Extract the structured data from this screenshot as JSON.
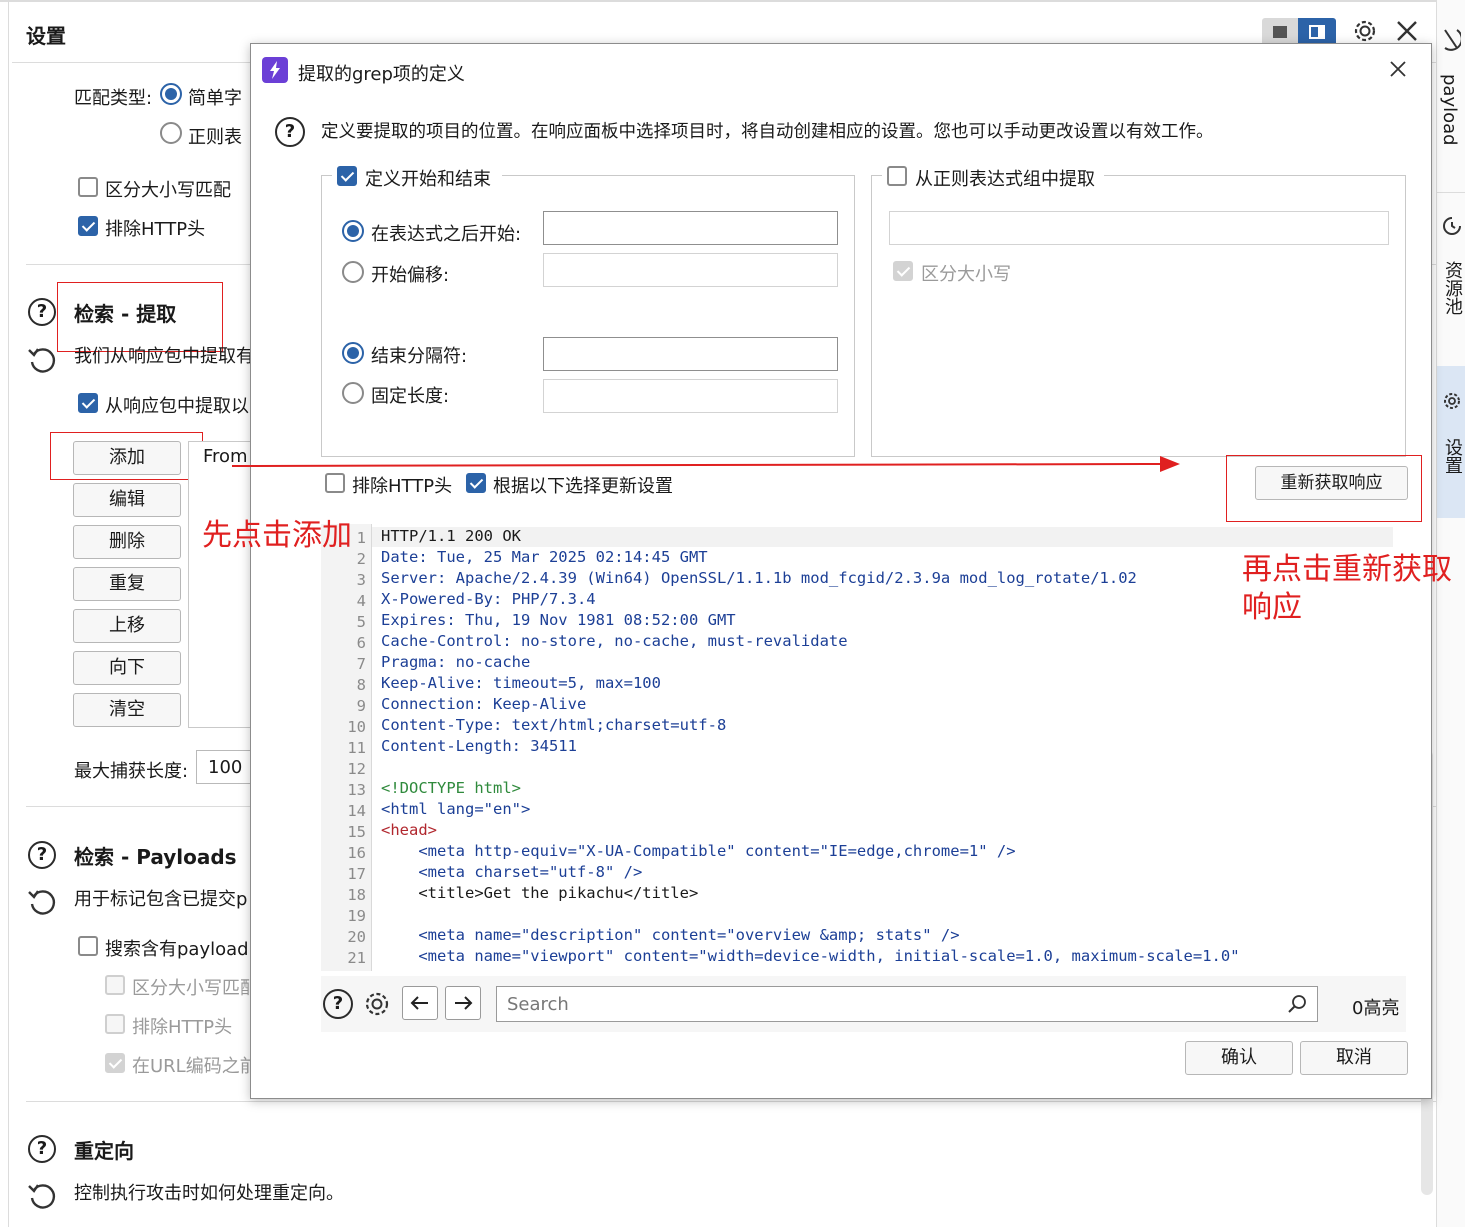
{
  "background": {
    "title": "设置",
    "match_type": {
      "label": "匹配类型:",
      "option1": "简单字",
      "option2": "正则表"
    },
    "case_sensitive": "区分大小写匹配",
    "exclude_http": "排除HTTP头",
    "grep_extract": {
      "title": "检索 - 提取",
      "desc": "我们从响应包中提取有",
      "checkbox": "从响应包中提取以"
    },
    "buttons": {
      "add": "添加",
      "edit": "编辑",
      "delete": "删除",
      "repeat": "重复",
      "up": "上移",
      "down": "向下",
      "clear": "清空"
    },
    "list_first": "From",
    "max_capture_label": "最大捕获长度:",
    "max_capture_value": "100",
    "grep_payloads": {
      "title": "检索 - Payloads",
      "desc": "用于标记包含已提交p",
      "checkbox": "搜索含有payload",
      "case": "区分大小写匹配",
      "exclude": "排除HTTP头",
      "url_encode": "在URL编码之前"
    },
    "redirect": {
      "title": "重定向",
      "desc": "控制执行攻击时如何处理重定向。"
    },
    "right_tabs": {
      "payload": "payload",
      "resource": "资源池",
      "settings": "设置"
    }
  },
  "dialog": {
    "title": "提取的grep项的定义",
    "description": "定义要提取的项目的位置。在响应面板中选择项目时，将自动创建相应的设置。您也可以手动更改设置以有效工作。",
    "left_group": {
      "checkbox": "定义开始和结束",
      "start_after": "在表达式之后开始:",
      "start_offset": "开始偏移:",
      "end_delimiter": "结束分隔符:",
      "fixed_length": "固定长度:"
    },
    "right_group": {
      "checkbox": "从正则表达式组中提取",
      "case": "区分大小写"
    },
    "exclude_http": "排除HTTP头",
    "update_config": "根据以下选择更新设置",
    "refetch": "重新获取响应",
    "search_placeholder": "Search",
    "highlights": "0高亮",
    "ok": "确认",
    "cancel": "取消"
  },
  "response_lines": [
    "HTTP/1.1 200 OK",
    "Date: Tue, 25 Mar 2025 02:14:45 GMT",
    "Server: Apache/2.4.39 (Win64) OpenSSL/1.1.1b mod_fcgid/2.3.9a mod_log_rotate/1.02",
    "X-Powered-By: PHP/7.3.4",
    "Expires: Thu, 19 Nov 1981 08:52:00 GMT",
    "Cache-Control: no-store, no-cache, must-revalidate",
    "Pragma: no-cache",
    "Keep-Alive: timeout=5, max=100",
    "Connection: Keep-Alive",
    "Content-Type: text/html;charset=utf-8",
    "Content-Length: 34511",
    "",
    "<!DOCTYPE html>",
    "<html lang=\"en\">",
    "<head>",
    "    <meta http-equiv=\"X-UA-Compatible\" content=\"IE=edge,chrome=1\" />",
    "    <meta charset=\"utf-8\" />",
    "    <title>Get the pikachu</title>",
    "",
    "    <meta name=\"description\" content=\"overview &amp; stats\" />",
    "    <meta name=\"viewport\" content=\"width=device-width, initial-scale=1.0, maximum-scale=1.0\""
  ],
  "annotations": {
    "click_add": "先点击添加",
    "click_refetch_1": "再点击重新获取",
    "click_refetch_2": "响应"
  },
  "colors": {
    "accent": "#2c63a8",
    "annotation_red": "#e02020",
    "header_key": "#1c3f96",
    "value": "#b1272e",
    "tag": "#2f8a3c"
  }
}
